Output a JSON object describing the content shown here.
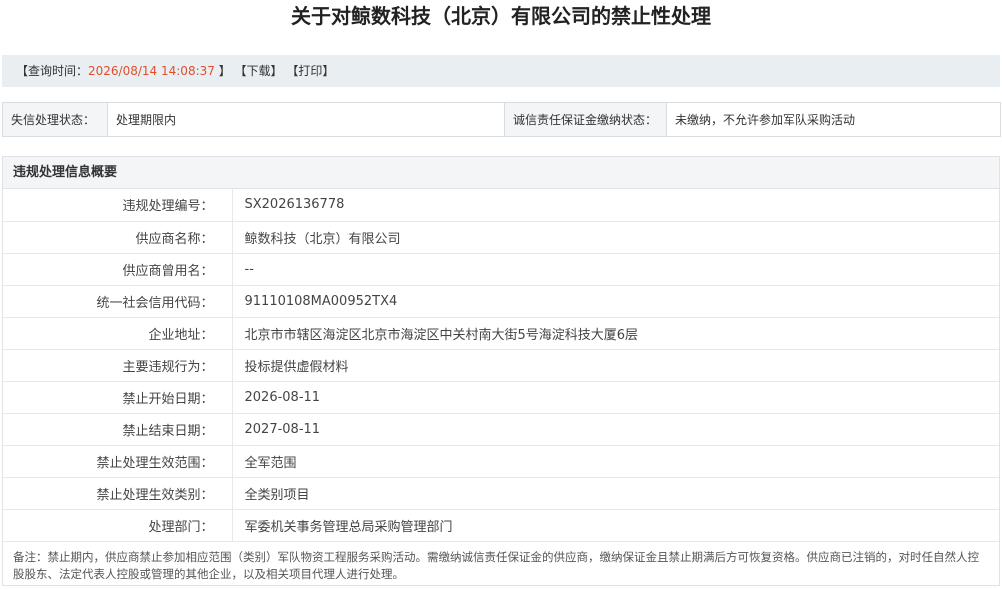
{
  "title": "关于对鲸数科技（北京）有限公司的禁止性处理",
  "query_bar": {
    "time_label": "【查询时间：",
    "time_value": "2026/08/14 14:08:37",
    "time_close": " 】",
    "download": "【下载】",
    "print": "【打印】"
  },
  "status": {
    "credit_status_label": "失信处理状态：",
    "credit_status_value": "处理期限内",
    "deposit_label": "诚信责任保证金缴纳状态：",
    "deposit_value": "未缴纳，不允许参加军队采购活动"
  },
  "section": {
    "title": "违规处理信息概要",
    "rows": [
      {
        "label": "违规处理编号：",
        "value": "SX2026136778"
      },
      {
        "label": "供应商名称：",
        "value": "鲸数科技（北京）有限公司"
      },
      {
        "label": "供应商曾用名：",
        "value": "--"
      },
      {
        "label": "统一社会信用代码：",
        "value": "91110108MA00952TX4"
      },
      {
        "label": "企业地址：",
        "value": "北京市市辖区海淀区北京市海淀区中关村南大街5号海淀科技大厦6层"
      },
      {
        "label": "主要违规行为：",
        "value": "投标提供虚假材料"
      },
      {
        "label": "禁止开始日期：",
        "value": "2026-08-11"
      },
      {
        "label": "禁止结束日期：",
        "value": "2027-08-11"
      },
      {
        "label": "禁止处理生效范围：",
        "value": "全军范围"
      },
      {
        "label": "禁止处理生效类别：",
        "value": "全类别项目"
      },
      {
        "label": "处理部门：",
        "value": "军委机关事务管理总局采购管理部门"
      }
    ],
    "remark": "备注：禁止期内，供应商禁止参加相应范围（类别）军队物资工程服务采购活动。需缴纳诚信责任保证金的供应商，缴纳保证金且禁止期满后方可恢复资格。供应商已注销的，对时任自然人控股股东、法定代表人控股或管理的其他企业，以及相关项目代理人进行处理。"
  }
}
